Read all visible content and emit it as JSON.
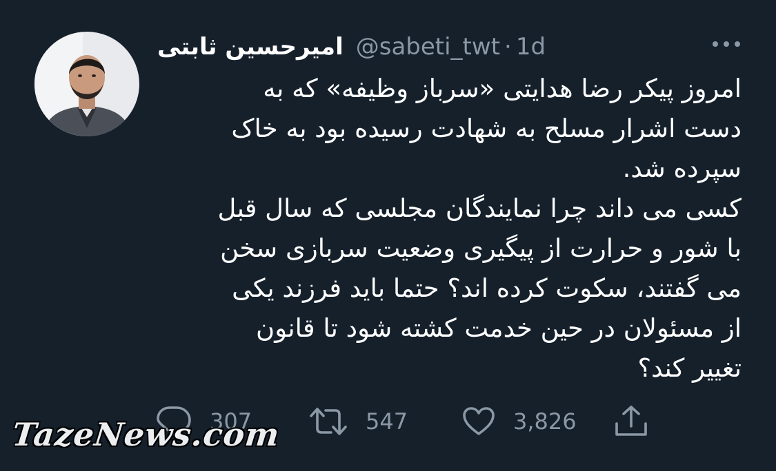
{
  "author": {
    "display_name": "امیرحسین ثابتی",
    "handle": "@sabeti_twt",
    "separator": "·",
    "time": "1d",
    "avatar_icon": "profile-photo"
  },
  "tweet": {
    "lines": [
      "امروز پیکر رضا هدایتی «سرباز وظیفه» که به",
      "دست اشرار مسلح به شهادت رسیده بود به خاک",
      "سپرده شد.",
      "کسی می داند چرا نمایندگان مجلسی که سال قبل",
      "با شور و حرارت از پیگیری وضعیت سربازی سخن",
      "می گفتند، سکوت کرده اند؟ حتما باید فرزند یکی",
      "از مسئولان در حین خدمت کشته شود تا قانون",
      "تغییر کند؟"
    ]
  },
  "actions": {
    "reply": {
      "icon": "reply-icon",
      "count": "307"
    },
    "retweet": {
      "icon": "retweet-icon",
      "count": "547"
    },
    "like": {
      "icon": "heart-icon",
      "count": "3,826"
    },
    "share": {
      "icon": "share-icon"
    }
  },
  "watermark": "TazeNews.com",
  "colors": {
    "background": "#15202b",
    "text": "#ffffff",
    "secondary": "#8b98a5"
  }
}
